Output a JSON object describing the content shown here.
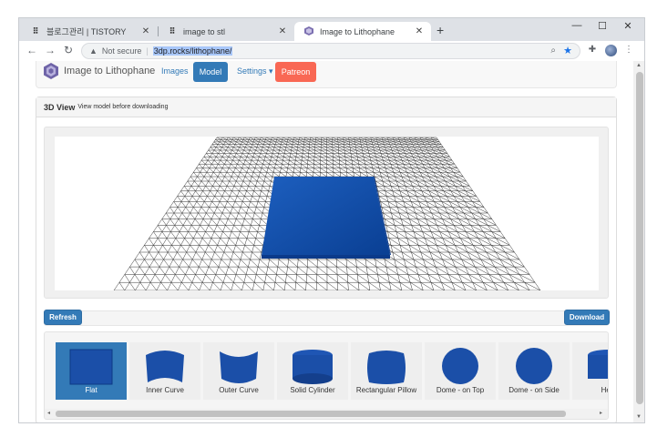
{
  "browser": {
    "tabs": [
      {
        "title": "블로그관리 | TISTORY",
        "favicon": "T"
      },
      {
        "title": "image to stl",
        "favicon": "T"
      },
      {
        "title": "Image to Lithophane",
        "favicon": "cube"
      }
    ],
    "security_label": "Not secure",
    "url": "3dp.rocks/lithophane/"
  },
  "site": {
    "brand": "Image to Lithophane",
    "nav": {
      "images": "Images",
      "model": "Model",
      "settings": "Settings ▾",
      "patreon": "Patreon"
    }
  },
  "panel": {
    "title": "3D View",
    "subtitle": "View model before downloading"
  },
  "buttons": {
    "refresh": "Refresh",
    "download": "Download"
  },
  "shapes": [
    {
      "label": "Flat",
      "selected": true
    },
    {
      "label": "Inner Curve",
      "selected": false
    },
    {
      "label": "Outer Curve",
      "selected": false
    },
    {
      "label": "Solid Cylinder",
      "selected": false
    },
    {
      "label": "Rectangular Pillow",
      "selected": false
    },
    {
      "label": "Dome - on Top",
      "selected": false
    },
    {
      "label": "Dome - on Side",
      "selected": false
    },
    {
      "label": "Hea",
      "selected": false
    }
  ],
  "colors": {
    "primary": "#337ab7",
    "patreon": "#f96854",
    "model": "#0d4aa6"
  }
}
